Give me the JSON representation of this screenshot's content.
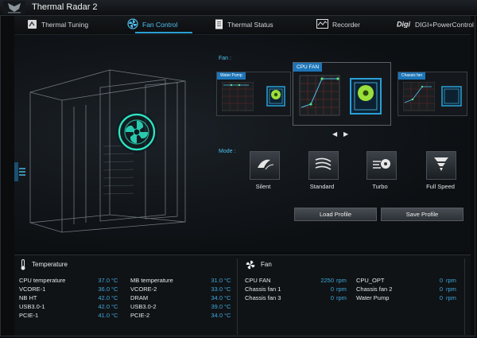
{
  "app": {
    "title": "Thermal Radar 2"
  },
  "tabs": [
    {
      "label": "Thermal Tuning",
      "icon": "thermal-tuning-icon"
    },
    {
      "label": "Fan Control",
      "icon": "fan-icon",
      "active": true
    },
    {
      "label": "Thermal Status",
      "icon": "document-icon"
    },
    {
      "label": "Recorder",
      "icon": "recorder-icon"
    },
    {
      "label": "DIGI+PowerControl",
      "icon": "digi-icon"
    }
  ],
  "fan_section": {
    "label": "Fan :",
    "cards": [
      {
        "title": "Water Pump"
      },
      {
        "title": "CPU FAN"
      },
      {
        "title": "Chassis fan"
      }
    ]
  },
  "mode_section": {
    "label": "Mode :",
    "modes": [
      {
        "label": "Silent",
        "icon": "silent-mode-icon"
      },
      {
        "label": "Standard",
        "icon": "standard-mode-icon"
      },
      {
        "label": "Turbo",
        "icon": "turbo-mode-icon"
      },
      {
        "label": "Full Speed",
        "icon": "full-speed-mode-icon"
      }
    ]
  },
  "buttons": {
    "load": "Load Profile",
    "save": "Save Profile"
  },
  "temperature": {
    "title": "Temperature",
    "col1": [
      {
        "label": "CPU temperature",
        "value": "37.0",
        "unit": "°C"
      },
      {
        "label": "VCORE-1",
        "value": "36.0",
        "unit": "°C"
      },
      {
        "label": "NB HT",
        "value": "42.0",
        "unit": "°C"
      },
      {
        "label": "USB3.0-1",
        "value": "42.0",
        "unit": "°C"
      },
      {
        "label": "PCIE-1",
        "value": "41.0",
        "unit": "°C"
      }
    ],
    "col2": [
      {
        "label": "MB temperature",
        "value": "31.0",
        "unit": "°C"
      },
      {
        "label": "VCORE-2",
        "value": "33.0",
        "unit": "°C"
      },
      {
        "label": "DRAM",
        "value": "34.0",
        "unit": "°C"
      },
      {
        "label": "USB3.0-2",
        "value": "39.0",
        "unit": "°C"
      },
      {
        "label": "PCIE-2",
        "value": "34.0",
        "unit": "°C"
      }
    ]
  },
  "fan": {
    "title": "Fan",
    "col1": [
      {
        "label": "CPU FAN",
        "value": "2250",
        "unit": "rpm"
      },
      {
        "label": "Chassis fan 1",
        "value": "0",
        "unit": "rpm"
      },
      {
        "label": "Chassis fan 3",
        "value": "0",
        "unit": "rpm"
      }
    ],
    "col2": [
      {
        "label": "CPU_OPT",
        "value": "0",
        "unit": "rpm"
      },
      {
        "label": "Chassis fan 2",
        "value": "0",
        "unit": "rpm"
      },
      {
        "label": "Water Pump",
        "value": "0",
        "unit": "rpm"
      }
    ]
  },
  "colors": {
    "accent": "#2a9fd6",
    "fan_glow": "#2ee6c8",
    "value_blue": "#3da8e0",
    "card_title_blue": "#1d75b8"
  }
}
